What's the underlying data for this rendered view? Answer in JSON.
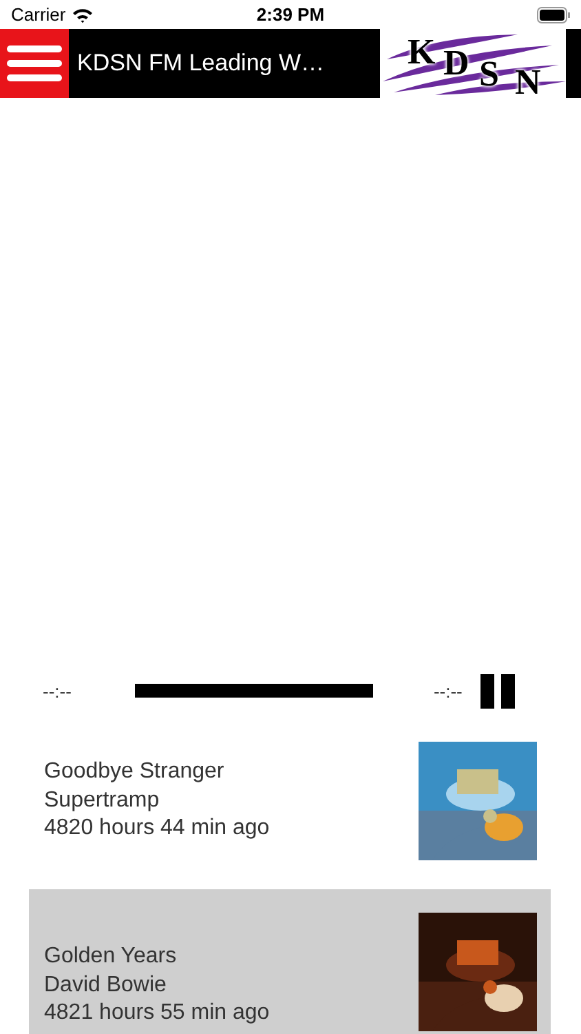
{
  "status_bar": {
    "carrier": "Carrier",
    "time": "2:39 PM"
  },
  "header": {
    "title": "KDSN FM Leading W…",
    "logo": [
      "K",
      "D",
      "S",
      "N"
    ]
  },
  "player": {
    "elapsed": "--:--",
    "remaining": "--:--"
  },
  "tracks": [
    {
      "title": "Goodbye Stranger",
      "artist": "Supertramp",
      "played": "4820 hours 44 min ago",
      "selected": false
    },
    {
      "title": "Golden Years",
      "artist": "David Bowie",
      "played": "4821 hours 55 min ago",
      "selected": true
    }
  ]
}
